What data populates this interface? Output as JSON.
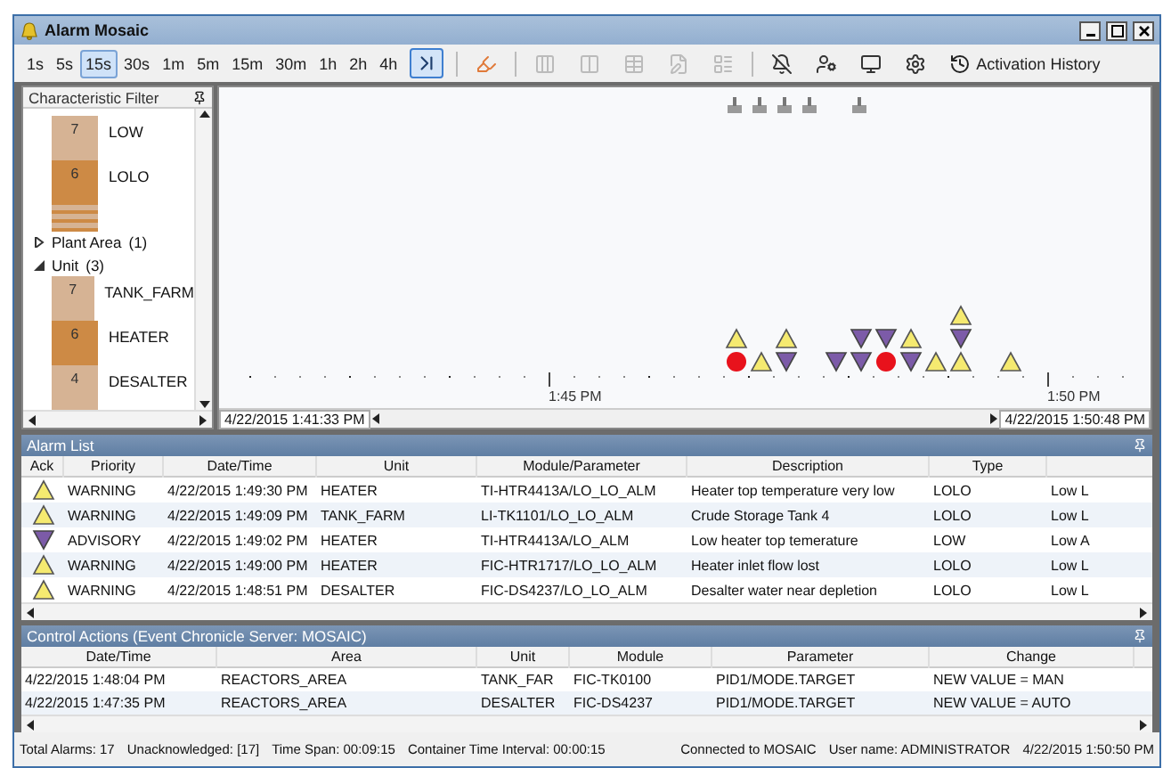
{
  "window": {
    "title": "Alarm Mosaic"
  },
  "toolbar": {
    "time_buttons": [
      {
        "label": "1s",
        "selected": false
      },
      {
        "label": "5s",
        "selected": false
      },
      {
        "label": "15s",
        "selected": true
      },
      {
        "label": "30s",
        "selected": false
      },
      {
        "label": "1m",
        "selected": false
      },
      {
        "label": "5m",
        "selected": false
      },
      {
        "label": "15m",
        "selected": false
      },
      {
        "label": "30m",
        "selected": false
      },
      {
        "label": "1h",
        "selected": false
      },
      {
        "label": "2h",
        "selected": false
      },
      {
        "label": "4h",
        "selected": false
      }
    ],
    "latest_button": {
      "selected": true
    },
    "tools": [
      {
        "kind": "highlight",
        "disabled": false
      },
      {
        "kind": "columns",
        "disabled": true
      },
      {
        "kind": "split",
        "disabled": true
      },
      {
        "kind": "table",
        "disabled": true
      },
      {
        "kind": "edit",
        "disabled": true
      },
      {
        "kind": "list",
        "disabled": true
      },
      {
        "kind": "bell",
        "disabled": false
      },
      {
        "kind": "user",
        "disabled": false
      },
      {
        "kind": "monitor",
        "disabled": false
      },
      {
        "kind": "settings",
        "disabled": false
      }
    ],
    "history_button": "Activation History"
  },
  "filter": {
    "title": "Characteristic Filter",
    "groups": [
      {
        "bars": [
          {
            "count": "7",
            "label": "LOW",
            "kind": "light"
          },
          {
            "count": "6",
            "label": "LOLO",
            "kind": "dark"
          },
          {
            "kind": "stripes"
          }
        ]
      },
      {
        "name": "Plant Area",
        "count": "(1)",
        "expanded": false
      },
      {
        "name": "Unit",
        "count": "(3)",
        "expanded": true,
        "bars": [
          {
            "count": "7",
            "label": "TANK_FARM",
            "kind": "light"
          },
          {
            "count": "6",
            "label": "HEATER",
            "kind": "dark"
          },
          {
            "count": "4",
            "label": "DESALTER",
            "kind": "light"
          }
        ]
      }
    ]
  },
  "timeline": {
    "start": "4/22/2015 1:41:33 PM",
    "end": "4/22/2015 1:50:48 PM",
    "axis_labels": [
      "1:45 PM",
      "1:50 PM"
    ],
    "slots": [
      {
        "flag": true,
        "markers": [
          {
            "kind": "circle"
          },
          {
            "kind": "up"
          }
        ]
      },
      {
        "flag": true,
        "markers": [
          {
            "kind": "up"
          }
        ]
      },
      {
        "flag": true,
        "markers": [
          {
            "kind": "down"
          },
          {
            "kind": "up"
          }
        ]
      },
      {
        "flag": true
      },
      {
        "flag": false,
        "markers": [
          {
            "kind": "down"
          }
        ]
      },
      {
        "flag": true,
        "markers": [
          {
            "kind": "down"
          },
          {
            "kind": "down"
          }
        ]
      },
      {
        "flag": false,
        "markers": [
          {
            "kind": "circle"
          },
          {
            "kind": "down"
          }
        ]
      },
      {
        "flag": false,
        "markers": [
          {
            "kind": "down"
          },
          {
            "kind": "up"
          }
        ]
      },
      {
        "flag": false,
        "markers": [
          {
            "kind": "up"
          }
        ]
      },
      {
        "flag": false,
        "markers": [
          {
            "kind": "up"
          },
          {
            "kind": "down"
          },
          {
            "kind": "up"
          }
        ]
      },
      {
        "flag": false
      },
      {
        "flag": false,
        "markers": [
          {
            "kind": "up"
          }
        ]
      }
    ]
  },
  "alarm_list": {
    "title": "Alarm List",
    "columns": [
      "Ack",
      "Priority",
      "Date/Time",
      "Unit",
      "Module/Parameter",
      "Description",
      "Type"
    ],
    "rows": [
      {
        "kind": "up",
        "priority": "WARNING",
        "time": "4/22/2015 1:49:30 PM",
        "unit": "HEATER",
        "module": "TI-HTR4413A/LO_LO_ALM",
        "description": "Heater top temperature very low",
        "type": "LOLO",
        "column_8": "Low L"
      },
      {
        "kind": "up",
        "priority": "WARNING",
        "time": "4/22/2015 1:49:09 PM",
        "unit": "TANK_FARM",
        "module": "LI-TK1101/LO_LO_ALM",
        "description": "Crude Storage Tank 4",
        "type": "LOLO",
        "column_8": "Low L"
      },
      {
        "kind": "down",
        "priority": "ADVISORY",
        "time": "4/22/2015 1:49:02 PM",
        "unit": "HEATER",
        "module": "TI-HTR4413A/LO_ALM",
        "description": "Low heater top temerature",
        "type": "LOW",
        "column_8": "Low A"
      },
      {
        "kind": "up",
        "priority": "WARNING",
        "time": "4/22/2015 1:49:00 PM",
        "unit": "HEATER",
        "module": "FIC-HTR1717/LO_LO_ALM",
        "description": "Heater inlet flow lost",
        "type": "LOLO",
        "column_8": "Low L"
      },
      {
        "kind": "up",
        "priority": "WARNING",
        "time": "4/22/2015 1:48:51 PM",
        "unit": "DESALTER",
        "module": "FIC-DS4237/LO_LO_ALM",
        "description": "Desalter water near depletion",
        "type": "LOLO",
        "column_8": "Low L"
      }
    ]
  },
  "control_actions": {
    "title": "Control Actions (Event Chronicle Server: MOSAIC)",
    "columns": [
      "Date/Time",
      "Area",
      "Unit",
      "Module",
      "Parameter",
      "Change"
    ],
    "rows": [
      [
        "4/22/2015 1:48:04 PM",
        "REACTORS_AREA",
        "TANK_FAR",
        "FIC-TK0100",
        "PID1/MODE.TARGET",
        "NEW VALUE = MAN"
      ],
      [
        "4/22/2015 1:47:35 PM",
        "REACTORS_AREA",
        "DESALTER",
        "FIC-DS4237",
        "PID1/MODE.TARGET",
        "NEW VALUE = AUTO"
      ]
    ]
  },
  "status_bar": {
    "left": [
      "Total Alarms: 17",
      "Unacknowledged: [17]",
      "Time Span: 00:09:15",
      "Container Time Interval: 00:00:15"
    ],
    "right": [
      "Connected to MOSAIC",
      "User name:  ADMINISTRATOR",
      "4/22/2015 1:50:50 PM"
    ]
  }
}
